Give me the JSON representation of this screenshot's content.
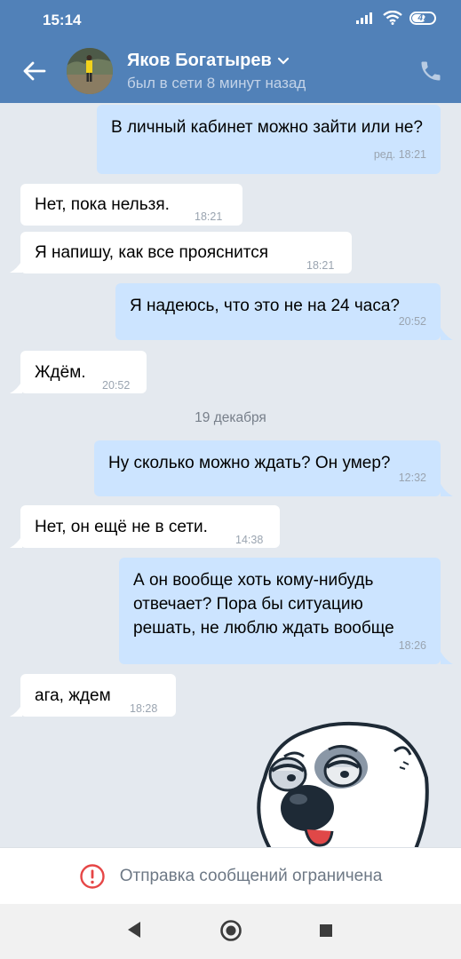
{
  "status": {
    "time": "15:14",
    "battery": "47"
  },
  "header": {
    "contact_name": "Яков Богатырев",
    "contact_status": "был в сети 8 минут назад"
  },
  "messages": [
    {
      "dir": "out",
      "text": "В личный кабинет можно зайти или не?",
      "time": "ред. 18:21"
    },
    {
      "dir": "in",
      "text": "Нет, пока нельзя.",
      "time": "18:21"
    },
    {
      "dir": "in",
      "text": "Я напишу, как все прояснится",
      "time": "18:21"
    },
    {
      "dir": "out",
      "text": "Я надеюсь, что это не на 24 часа?",
      "time": "20:52"
    },
    {
      "dir": "in",
      "text": "Ждём.",
      "time": "20:52"
    },
    {
      "dir": "out",
      "text": "Ну сколько можно ждать? Он умер?",
      "time": "12:32"
    },
    {
      "dir": "in",
      "text": "Нет, он ещё не в сети.",
      "time": "14:38"
    },
    {
      "dir": "out",
      "text": "А он вообще хоть кому-нибудь отвечает? Пора бы ситуацию решать, не люблю ждать вообще",
      "time": "18:26"
    },
    {
      "dir": "in",
      "text": "ага, ждем",
      "time": "18:28"
    }
  ],
  "date_separator": "19 декабря",
  "footer": {
    "restriction_text": "Отправка сообщений ограничена"
  },
  "colors": {
    "header": "#5181b8",
    "incoming": "#ffffff",
    "outgoing": "#cce4ff",
    "background": "#e4e9ef",
    "alert": "#e64646"
  }
}
